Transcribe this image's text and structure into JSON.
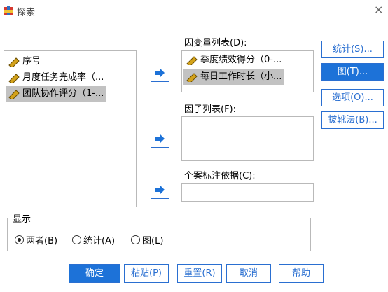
{
  "window": {
    "title": "探索",
    "close_glyph": "×"
  },
  "source_list": {
    "items": [
      {
        "label": "序号",
        "selected": false,
        "icon": "ruler-icon"
      },
      {
        "label": "月度任务完成率（...",
        "selected": false,
        "icon": "ruler-icon"
      },
      {
        "label": "团队协作评分（1-...",
        "selected": true,
        "icon": "ruler-icon"
      }
    ]
  },
  "dependent_list": {
    "label": "因变量列表(D):",
    "items": [
      {
        "label": "季度绩效得分（0-...",
        "selected": false,
        "icon": "ruler-icon"
      },
      {
        "label": "每日工作时长（小...",
        "selected": true,
        "icon": "ruler-icon"
      }
    ]
  },
  "factor_list": {
    "label": "因子列表(F):"
  },
  "case_label": {
    "label": "个案标注依据(C):"
  },
  "side_buttons": {
    "statistics": "统计(S)...",
    "plots": "图(T)...",
    "options": "选项(O)...",
    "bootstrap": "拔靴法(B)..."
  },
  "display": {
    "legend": "显示",
    "options": [
      {
        "label": "两者(B)",
        "checked": true
      },
      {
        "label": "统计(A)",
        "checked": false
      },
      {
        "label": "图(L)",
        "checked": false
      }
    ]
  },
  "bottom_buttons": {
    "ok": "确定",
    "paste": "粘贴(P)",
    "reset": "重置(R)",
    "cancel": "取消",
    "help": "帮助"
  },
  "colors": {
    "accent": "#1d72d8",
    "selection": "#c2c2c2",
    "ruler": "#d4a21a"
  }
}
